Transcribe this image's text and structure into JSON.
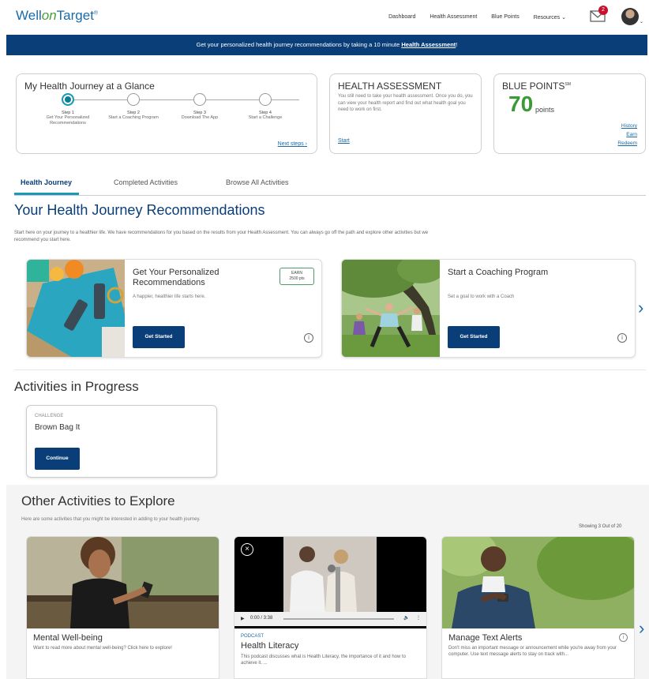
{
  "nav": {
    "logo_well": "Well",
    "logo_on": "on",
    "logo_target": "Target",
    "logo_reg": "®",
    "links": [
      "Dashboard",
      "Health Assessment",
      "Blue Points",
      "Resources"
    ],
    "resources_caret": "⌄",
    "mail_badge": "2"
  },
  "banner": {
    "text": "Get your personalized health journey recommendations by taking a 10 minute ",
    "link": "Health Assessment",
    "end": "!"
  },
  "glance": {
    "title": "My Health Journey at a Glance",
    "steps": [
      {
        "num": "Step 1",
        "label": "Get Your Personalized Recommendations"
      },
      {
        "num": "Step 2",
        "label": "Start a Coaching Program"
      },
      {
        "num": "Step 3",
        "label": "Download The App"
      },
      {
        "num": "Step 4",
        "label": "Start a Challenge"
      }
    ],
    "next": "Next steps ›"
  },
  "health_assessment": {
    "title": "HEALTH ASSESSMENT",
    "body": "You still need to take your health assessment. Once you do, you can view your health report and find out what health goal you need to work on first.",
    "start": "Start"
  },
  "blue_points": {
    "title": "BLUE POINTS",
    "sm": "SM",
    "value": "70",
    "unit": "points",
    "links": [
      "History",
      "Earn",
      "Redeem"
    ]
  },
  "tabs": [
    "Health Journey",
    "Completed Activities",
    "Browse All Activities"
  ],
  "recs": {
    "title": "Your Health Journey Recommendations",
    "intro": "Start here on your journey to a healthier life. We have recommendations for you based on the results from your Health Assessment. You can always go off the path and explore other activities but we recommend you start here.",
    "cards": [
      {
        "title": "Get Your Personalized Recommendations",
        "desc": "A happier, healthier life starts here.",
        "btn": "Get Started",
        "earn_label": "EARN",
        "earn_pts": "2500 pts"
      },
      {
        "title": "Start a Coaching Program",
        "desc": "Set a goal to work with a Coach",
        "btn": "Get Started"
      }
    ]
  },
  "progress": {
    "title": "Activities in Progress",
    "kind": "CHALLENGE",
    "name": "Brown Bag It",
    "btn": "Continue"
  },
  "explore": {
    "title": "Other Activities to Explore",
    "intro": "Here are some activities that you might be interested in adding to your health journey.",
    "showing": "Showing 3 Out of 20",
    "cards": [
      {
        "title": "Mental Well-being",
        "desc": "Want to read more about mental well-being? Click here to explore!"
      },
      {
        "kind": "PODCAST",
        "title": "Health Literacy",
        "desc": "This podcast discusses what is Health Literacy, the importance of it and how to achieve it. ...",
        "time": "0:00 / 3:38"
      },
      {
        "title": "Manage Text Alerts",
        "desc": "Don't miss an important message or announcement while you're away from your computer. Use text message alerts to stay on track with..."
      }
    ]
  },
  "icons": {
    "chevron": "›",
    "info": "i",
    "close": "×",
    "play": "▶",
    "volume": "🔈",
    "more": "⋮"
  }
}
